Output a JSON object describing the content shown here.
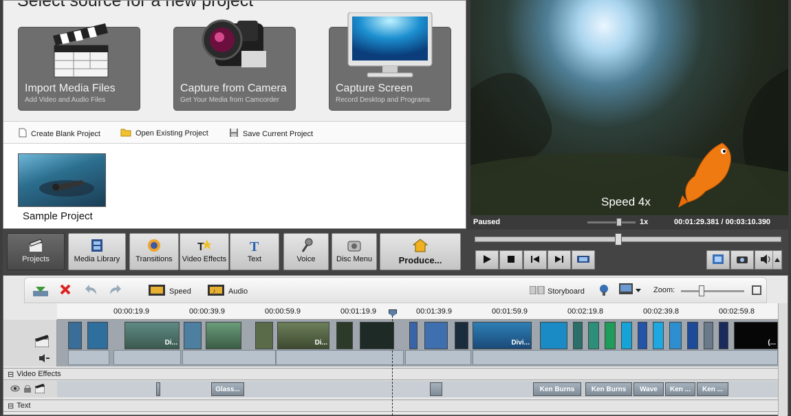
{
  "source_panel": {
    "title": "Select source for a new project",
    "cards": [
      {
        "title": "Import Media Files",
        "subtitle": "Add Video and Audio Files"
      },
      {
        "title": "Capture from Camera",
        "subtitle": "Get Your Media from Camcorder"
      },
      {
        "title": "Capture Screen",
        "subtitle": "Record Desktop and Programs"
      }
    ],
    "actions": [
      "Create Blank Project",
      "Open Existing Project",
      "Save Current Project"
    ],
    "sample_label": "Sample Project"
  },
  "preview": {
    "overlay_text": "Speed 4x",
    "status": "Paused",
    "speed": "1x",
    "time": "00:01:29.381 / 00:03:10.390"
  },
  "toolbar": {
    "tabs": [
      "Projects",
      "Media Library",
      "Transitions",
      "Video Effects",
      "Text",
      "Voice",
      "Disc Menu",
      "Produce..."
    ]
  },
  "timeline": {
    "speed_label": "Speed",
    "audio_label": "Audio",
    "storyboard_label": "Storyboard",
    "zoom_label": "Zoom:",
    "ticks": [
      "00:00:19.9",
      "00:00:39.9",
      "00:00:59.9",
      "00:01:19.9",
      "00:01:39.9",
      "00:01:59.9",
      "00:02:19.8",
      "00:02:39.8",
      "00:02:59.8"
    ],
    "clip_labels": [
      "Di...",
      "Di...",
      "Divi...",
      "(..."
    ],
    "video_effects_header": "Video Effects",
    "text_header": "Text",
    "effects": [
      "Glass...",
      "Ken Burns",
      "Ken Burns",
      "Wave",
      "Ken ...",
      "Ken ..."
    ]
  },
  "colors": {
    "panel_bg": "#3d3d3d",
    "active_tab": "#555555",
    "clip_blue": "#2d5f86"
  }
}
